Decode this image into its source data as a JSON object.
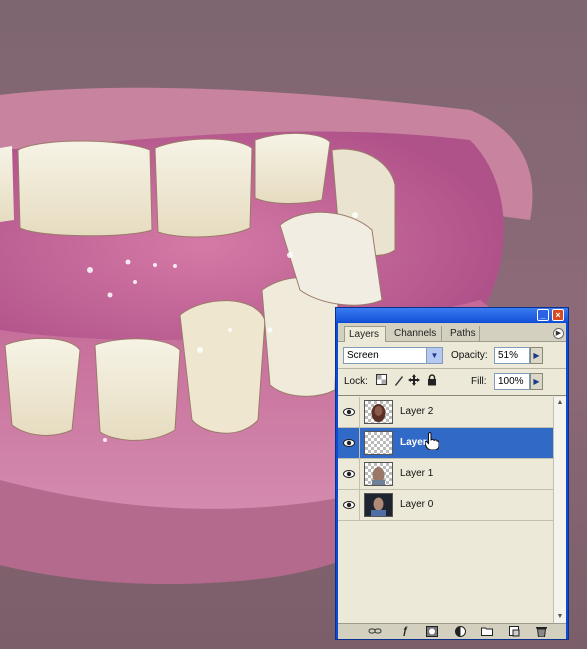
{
  "palette": {
    "tabs": [
      "Layers",
      "Channels",
      "Paths"
    ],
    "active_tab": "Layers",
    "blend_mode": "Screen",
    "opacity_label": "Opacity:",
    "opacity_value": "51%",
    "lock_label": "Lock:",
    "fill_label": "Fill:",
    "fill_value": "100%",
    "layers": [
      {
        "name": "Layer 2",
        "visible": true,
        "selected": false
      },
      {
        "name": "Layer",
        "visible": true,
        "selected": true
      },
      {
        "name": "Layer 1",
        "visible": true,
        "selected": false
      },
      {
        "name": "Layer 0",
        "visible": true,
        "selected": false
      }
    ]
  },
  "icons": {
    "window_buttons": [
      "minimize-icon",
      "close-icon"
    ],
    "lock": [
      "lock-transparent-icon",
      "lock-paint-icon",
      "lock-move-icon",
      "lock-all-icon"
    ],
    "bottom": [
      "link-icon",
      "layer-style-icon",
      "mask-icon",
      "adjustment-icon",
      "group-icon",
      "new-layer-icon",
      "trash-icon"
    ]
  },
  "colors": {
    "selection": "#3169c6",
    "titlebar": "#0a4bd6",
    "panel": "#ece9d8"
  }
}
